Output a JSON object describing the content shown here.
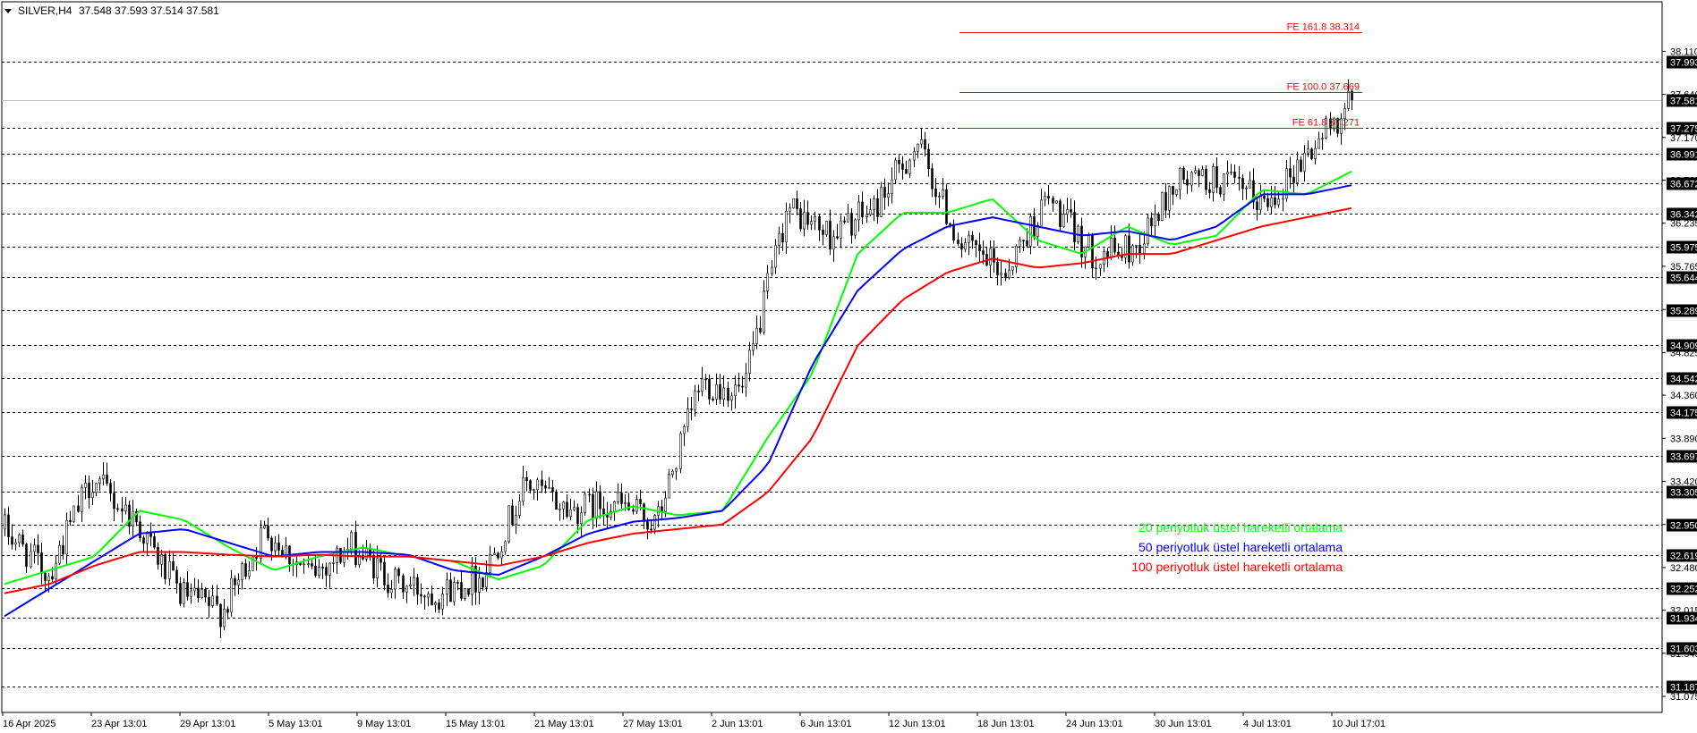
{
  "header": {
    "symbol": "SILVER,H4",
    "ohlc": "37.548 37.593 37.514 37.581"
  },
  "chart_data": {
    "type": "candlestick",
    "symbol": "SILVER",
    "timeframe": "H4",
    "ylim": [
      30.9,
      38.65
    ],
    "grid": false,
    "x_labels": [
      "16 Apr 2025",
      "23 Apr 13:01",
      "29 Apr 13:01",
      "5 May 13:01",
      "9 May 13:01",
      "15 May 13:01",
      "21 May 13:01",
      "27 May 13:01",
      "2 Jun 13:01",
      "6 Jun 13:01",
      "12 Jun 13:01",
      "18 Jun 13:01",
      "24 Jun 13:01",
      "30 Jun 13:01",
      "4 Jul 13:01",
      "10 Jul 17:01"
    ],
    "y_ticks": [
      "38.110",
      "37.640",
      "37.170",
      "36.705",
      "36.235",
      "35.765",
      "35.295",
      "34.825",
      "34.360",
      "33.890",
      "33.420",
      "32.950",
      "32.480",
      "32.015",
      "31.545",
      "31.075"
    ],
    "horizontal_levels": [
      "37.993",
      "37.581",
      "37.275",
      "36.991",
      "36.672",
      "36.342",
      "35.975",
      "35.644",
      "35.289",
      "34.909",
      "34.542",
      "34.175",
      "33.697",
      "33.305",
      "32.950",
      "32.619",
      "32.252",
      "31.934",
      "31.603",
      "31.187"
    ],
    "current_price": "37.581",
    "fibonacci_extensions": [
      {
        "label": "FE 161.8 38.314",
        "value": 38.314
      },
      {
        "label": "FE 100.0 37.669",
        "value": 37.669
      },
      {
        "label": "FE 61.8 37.271",
        "value": 37.271
      }
    ],
    "price_path": [
      {
        "x": "16 Apr 2025",
        "y": 32.9
      },
      {
        "x": "~",
        "y": 32.4
      },
      {
        "x": "23 Apr 13:01",
        "y": 33.45
      },
      {
        "x": "~",
        "y": 33.0
      },
      {
        "x": "29 Apr 13:01",
        "y": 32.2
      },
      {
        "x": "~",
        "y": 32.0
      },
      {
        "x": "5 May 13:01",
        "y": 32.9
      },
      {
        "x": "~",
        "y": 32.4
      },
      {
        "x": "9 May 13:01",
        "y": 32.7
      },
      {
        "x": "~",
        "y": 32.3
      },
      {
        "x": "15 May 13:01",
        "y": 32.2
      },
      {
        "x": "~",
        "y": 32.4
      },
      {
        "x": "21 May 13:01",
        "y": 33.4
      },
      {
        "x": "~",
        "y": 33.1
      },
      {
        "x": "27 May 13:01",
        "y": 33.2
      },
      {
        "x": "~",
        "y": 32.95
      },
      {
        "x": "2 Jun 13:01",
        "y": 34.5
      },
      {
        "x": "~",
        "y": 34.4
      },
      {
        "x": "6 Jun 13:01",
        "y": 36.4
      },
      {
        "x": "~",
        "y": 36.1
      },
      {
        "x": "12 Jun 13:01",
        "y": 36.4
      },
      {
        "x": "~",
        "y": 37.1
      },
      {
        "x": "18 Jun 13:01",
        "y": 36.0
      },
      {
        "x": "~",
        "y": 35.7
      },
      {
        "x": "24 Jun 13:01",
        "y": 36.5
      },
      {
        "x": "~",
        "y": 35.9
      },
      {
        "x": "30 Jun 13:01",
        "y": 35.95
      },
      {
        "x": "~",
        "y": 36.7
      },
      {
        "x": "4 Jul 13:01",
        "y": 36.7
      },
      {
        "x": "~",
        "y": 36.45
      },
      {
        "x": "10 Jul 17:01",
        "y": 37.0
      },
      {
        "x": "latest",
        "y": 37.581
      }
    ],
    "series": [
      {
        "name": "20 periyotluk üstel hareketli ortalama",
        "color": "#00ff00",
        "values": [
          32.3,
          32.45,
          32.6,
          33.1,
          33.0,
          32.7,
          32.45,
          32.6,
          32.7,
          32.6,
          32.55,
          32.35,
          32.5,
          33.0,
          33.15,
          33.05,
          33.1,
          33.9,
          34.6,
          35.9,
          36.35,
          36.35,
          36.5,
          36.05,
          35.9,
          36.2,
          36.0,
          36.1,
          36.6,
          36.55,
          36.8
        ]
      },
      {
        "name": "50 periyotluk üstel hareketli ortalama",
        "color": "#0000ff",
        "values": [
          31.95,
          32.25,
          32.55,
          32.85,
          32.9,
          32.75,
          32.6,
          32.65,
          32.65,
          32.62,
          32.45,
          32.4,
          32.6,
          32.85,
          32.98,
          33.02,
          33.1,
          33.6,
          34.7,
          35.5,
          35.95,
          36.2,
          36.3,
          36.2,
          36.1,
          36.15,
          36.05,
          36.2,
          36.55,
          36.55,
          36.65
        ]
      },
      {
        "name": "100 periyotluk üstel hareketli ortalama",
        "color": "#ff0000",
        "values": [
          32.2,
          32.3,
          32.5,
          32.65,
          32.65,
          32.62,
          32.6,
          32.62,
          32.6,
          32.6,
          32.55,
          32.5,
          32.6,
          32.75,
          32.85,
          32.9,
          32.95,
          33.3,
          33.9,
          34.9,
          35.4,
          35.7,
          35.85,
          35.75,
          35.8,
          35.9,
          35.9,
          36.05,
          36.2,
          36.3,
          36.4
        ]
      }
    ]
  },
  "legend": [
    {
      "label": "20 periyotluk üstel hareketli ortalama",
      "color": "#00ff00"
    },
    {
      "label": "50 periyotluk üstel hareketli ortalama",
      "color": "#0000ff"
    },
    {
      "label": "100 periyotluk üstel hareketli ortalama",
      "color": "#ff0000"
    }
  ]
}
